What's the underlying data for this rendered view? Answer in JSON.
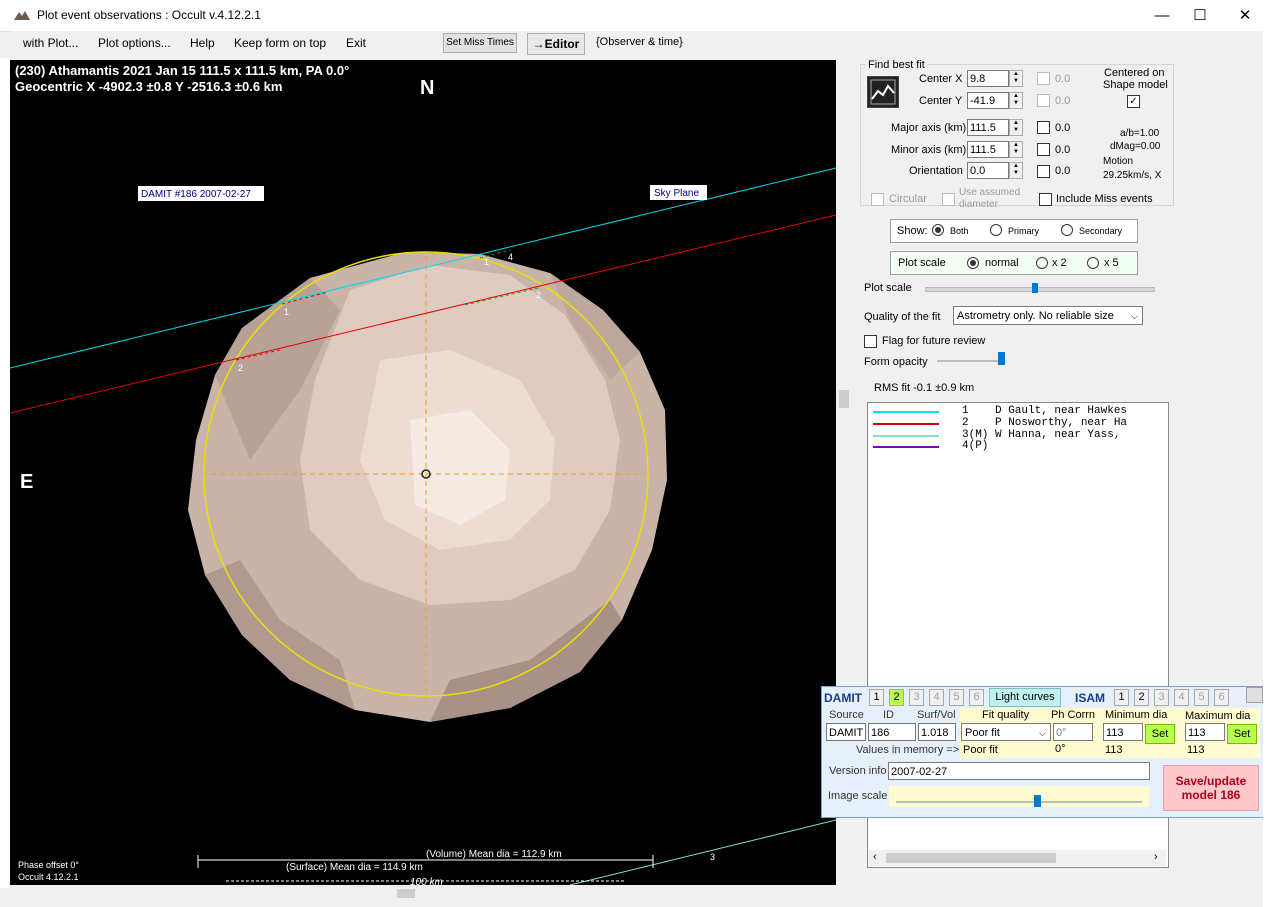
{
  "window": {
    "title": "Plot event observations : Occult v.4.12.2.1",
    "minimize": "—",
    "maximize": "☐",
    "close": "✕"
  },
  "menu": {
    "items": [
      "with Plot...",
      "Plot options...",
      "Help",
      "Keep form on top",
      "Exit"
    ],
    "set_miss_times": "Set Miss Times",
    "editor": "→Editor",
    "observer_time": "{Observer & time}"
  },
  "plot": {
    "header_line1": "(230) Athamantis  2021 Jan 15   111.5 x 111.5 km, PA 0.0°",
    "header_line2": "Geocentric  X  -4902.3 ±0.8  Y  -2516.3 ±0.6 km",
    "north": "N",
    "east": "E",
    "damit_label": "DAMIT #186 2007-02-27",
    "sky_plane": "Sky Plane",
    "chord_labels": [
      "1",
      "2",
      "1",
      "2",
      "4",
      "3"
    ],
    "volume_dia": "(Volume) Mean dia = 112.9 km",
    "surface_dia": "(Surface) Mean dia = 114.9 km",
    "scale": "100 km",
    "phase_offset": "Phase offset 0°",
    "version": "Occult 4.12.2.1"
  },
  "fit": {
    "group_title": "Find best fit",
    "center_x_label": "Center X",
    "center_x": "9.8",
    "center_x_unc": "0.0",
    "center_y_label": "Center Y",
    "center_y": "-41.9",
    "center_y_unc": "0.0",
    "major_label": "Major axis (km)",
    "major": "111.5",
    "major_unc": "0.0",
    "minor_label": "Minor axis (km)",
    "minor": "111.5",
    "minor_unc": "0.0",
    "orient_label": "Orientation",
    "orient": "0.0",
    "orient_unc": "0.0",
    "centered_on": "Centered on",
    "shape_model": "Shape model",
    "ab": "a/b=1.00",
    "dmag": "dMag=0.00",
    "motion": "Motion",
    "motion_val": "29.25km/s, X",
    "circular": "Circular",
    "use_assumed": "Use assumed",
    "diameter": "diameter",
    "include_miss": "Include Miss events",
    "show_label": "Show:",
    "show_opts": [
      "Both",
      "Primary",
      "Secondary"
    ],
    "plot_scale_label": "Plot scale",
    "scale_opts": [
      "normal",
      "x 2",
      "x 5"
    ],
    "plot_scale_slider_label": "Plot scale",
    "quality_label": "Quality of the fit",
    "quality_value": "Astrometry only. No reliable size",
    "flag_review": "Flag for future review",
    "form_opacity": "Form opacity",
    "rms": "RMS fit  -0.1 ±0.9 km"
  },
  "observers": [
    {
      "color": "#00e5ee",
      "text": "1    D Gault, near Hawkes"
    },
    {
      "color": "#e00000",
      "text": "2    P Nosworthy, near Ha"
    },
    {
      "color": "#7ee6c0",
      "text": "3(M) W Hanna, near Yass,"
    },
    {
      "color": "#8000c0",
      "text": "4(P)"
    }
  ],
  "damit": {
    "title": "DAMIT",
    "tabs": [
      "1",
      "2",
      "3",
      "4",
      "5",
      "6"
    ],
    "light_curves": "Light curves",
    "isam_title": "ISAM",
    "isam_tabs": [
      "1",
      "2",
      "3",
      "4",
      "5",
      "6"
    ],
    "h_source": "Source",
    "h_id": "ID",
    "h_surfvol": "Surf/Vol",
    "h_fit": "Fit quality",
    "h_phcorr": "Ph Corrn",
    "h_min": "Minimum dia",
    "h_max": "Maximum dia",
    "source": "DAMIT",
    "id": "186",
    "surfvol": "1.018",
    "fit": "Poor fit",
    "phcorr": "0°",
    "min": "113",
    "max": "113",
    "set": "Set",
    "mem_label": "Values in memory =>",
    "mem_fit": "Poor fit",
    "mem_phcorr": "0°",
    "mem_min": "113",
    "mem_max": "113",
    "version_label": "Version info",
    "version": "2007-02-27",
    "image_scale": "Image scale",
    "save_line1": "Save/update",
    "save_line2": "model  186"
  }
}
